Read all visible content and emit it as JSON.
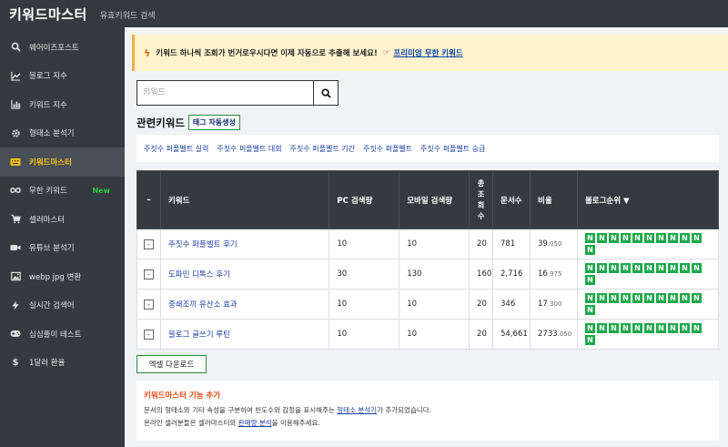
{
  "header": {
    "brand": "키워드마스터",
    "subtitle": "유효키워드 검색"
  },
  "sidebar": {
    "items": [
      {
        "icon": "search-icon",
        "label": "웨어이즈포스트",
        "badge": ""
      },
      {
        "icon": "line-chart-icon",
        "label": "블로그 지수",
        "badge": ""
      },
      {
        "icon": "bar-chart-icon",
        "label": "키워드 지수",
        "badge": ""
      },
      {
        "icon": "gear-icon",
        "label": "형태소 분석기",
        "badge": ""
      },
      {
        "icon": "keyboard-icon",
        "label": "키워드마스터",
        "badge": ""
      },
      {
        "icon": "infinity-icon",
        "label": "무한 키워드",
        "badge": "New"
      },
      {
        "icon": "cart-icon",
        "label": "셀러마스터",
        "badge": ""
      },
      {
        "icon": "video-icon",
        "label": "유튜브 분석기",
        "badge": ""
      },
      {
        "icon": "image-icon",
        "label": "webp jpg 변환",
        "badge": ""
      },
      {
        "icon": "lightning-icon",
        "label": "실시간 검색어",
        "badge": ""
      },
      {
        "icon": "gamepad-icon",
        "label": "심심풀이 테스트",
        "badge": ""
      },
      {
        "icon": "dollar-icon",
        "label": "1달러 환율",
        "badge": ""
      }
    ],
    "active_index": 4
  },
  "notice": {
    "text": "키워드 하나씩 조회가 번거로우시다면 이제 자동으로 추출해 보세요!",
    "link": "프리미엄 무한 키워드"
  },
  "search": {
    "placeholder": "키워드",
    "value": ""
  },
  "related": {
    "title": "관련키워드",
    "tag_button": "태그 자동생성",
    "keywords": [
      "주짓수 퍼플벨트 실력",
      "주짓수 퍼플벨트 대회",
      "주짓수 퍼플벨트 기간",
      "주짓수 퍼플벨트",
      "주짓수 퍼플벨트 승급"
    ]
  },
  "table": {
    "headers": {
      "toggle": "–",
      "keyword": "키워드",
      "pc": "PC 검색량",
      "mobile": "모바일 검색량",
      "views": [
        "총",
        "조",
        "회",
        "수"
      ],
      "docs": "문서수",
      "ratio": "비율",
      "rank": "블로그순위 ▼"
    },
    "rows": [
      {
        "toggle": "-",
        "keyword": "주짓수 퍼플벨트 후기",
        "pc": "10",
        "mobile": "10",
        "total": "20",
        "docs": "781",
        "ratio_main": "39",
        "ratio_dec": ".050",
        "ranks": [
          "N",
          "N",
          "N",
          "N",
          "N",
          "N",
          "N",
          "N",
          "N",
          "N",
          "N"
        ]
      },
      {
        "toggle": "-",
        "keyword": "도파민 디톡스 후기",
        "pc": "30",
        "mobile": "130",
        "total": "160",
        "docs": "2,716",
        "ratio_main": "16",
        "ratio_dec": ".975",
        "ranks": [
          "N",
          "N",
          "N",
          "N",
          "N",
          "N",
          "N",
          "N",
          "N",
          "N",
          "N"
        ]
      },
      {
        "toggle": "-",
        "keyword": "중쇄조끼 유산소 효과",
        "pc": "10",
        "mobile": "10",
        "total": "20",
        "docs": "346",
        "ratio_main": "17",
        "ratio_dec": ".300",
        "ranks": [
          "N",
          "N",
          "N",
          "N",
          "N",
          "N",
          "N",
          "N",
          "N",
          "N",
          "N"
        ]
      },
      {
        "toggle": "-",
        "keyword": "블로그 글쓰기 루틴",
        "pc": "10",
        "mobile": "10",
        "total": "20",
        "docs": "54,661",
        "ratio_main": "2733",
        "ratio_dec": ".050",
        "ranks": [
          "N",
          "N",
          "N",
          "N",
          "N",
          "N",
          "N",
          "N",
          "N",
          "N",
          "N"
        ]
      }
    ]
  },
  "excel_button": "엑셀 다운로드",
  "info": {
    "title": "키워드마스터 기능 추가",
    "line1_pre": "문서의 형태소와 기타 속성을 구분하여 빈도수와 감정을 표시해주는 ",
    "line1_link": "형태소 분석기",
    "line1_post": "가 추가되었습니다.",
    "line2_pre": "온라인 셀러분들은 셀러마스터와 ",
    "line2_link": "판매량 분석",
    "line2_post": "을 이용해주세요."
  },
  "colors": {
    "sidebar_bg": "#343a40",
    "active_text": "#ffc107",
    "new_badge": "#2ecc40",
    "rank_green": "#1da84a",
    "link": "#1a3d9e",
    "accent_orange": "#e8450c"
  }
}
